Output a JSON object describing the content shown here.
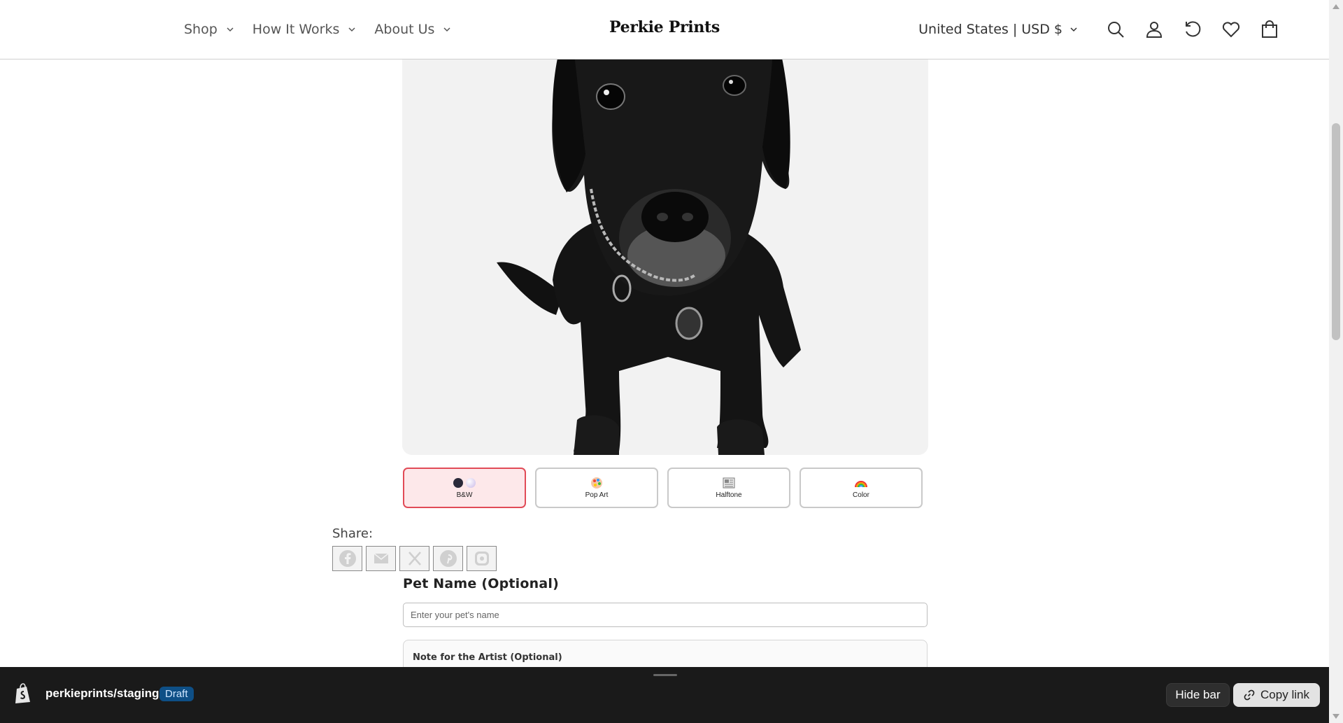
{
  "header": {
    "nav": [
      {
        "label": "Shop"
      },
      {
        "label": "How It Works"
      },
      {
        "label": "About Us"
      }
    ],
    "logo": "Perkie Prints",
    "currency": "United States | USD $",
    "icons": [
      "search-icon",
      "account-icon",
      "history-icon",
      "wishlist-icon",
      "cart-icon"
    ]
  },
  "product": {
    "image_alt": "black dog photo in black and white style"
  },
  "styles": {
    "options": [
      {
        "label": "B&W",
        "selected": true
      },
      {
        "label": "Pop Art",
        "selected": false
      },
      {
        "label": "Halftone",
        "selected": false
      },
      {
        "label": "Color",
        "selected": false
      }
    ],
    "selected_color": "#e14b57"
  },
  "share": {
    "label": "Share:",
    "icons": [
      "facebook-icon",
      "email-icon",
      "x-icon",
      "pinterest-icon",
      "instagram-icon"
    ]
  },
  "form": {
    "pet_name_label": "Pet Name (Optional)",
    "pet_name_placeholder": "Enter your pet's name",
    "pet_name_value": "",
    "note_label": "Note for the Artist (Optional)"
  },
  "preview_bar": {
    "store": "perkieprints/staging",
    "badge": "Draft",
    "hide_label": "Hide bar",
    "copy_label": "Copy link"
  }
}
